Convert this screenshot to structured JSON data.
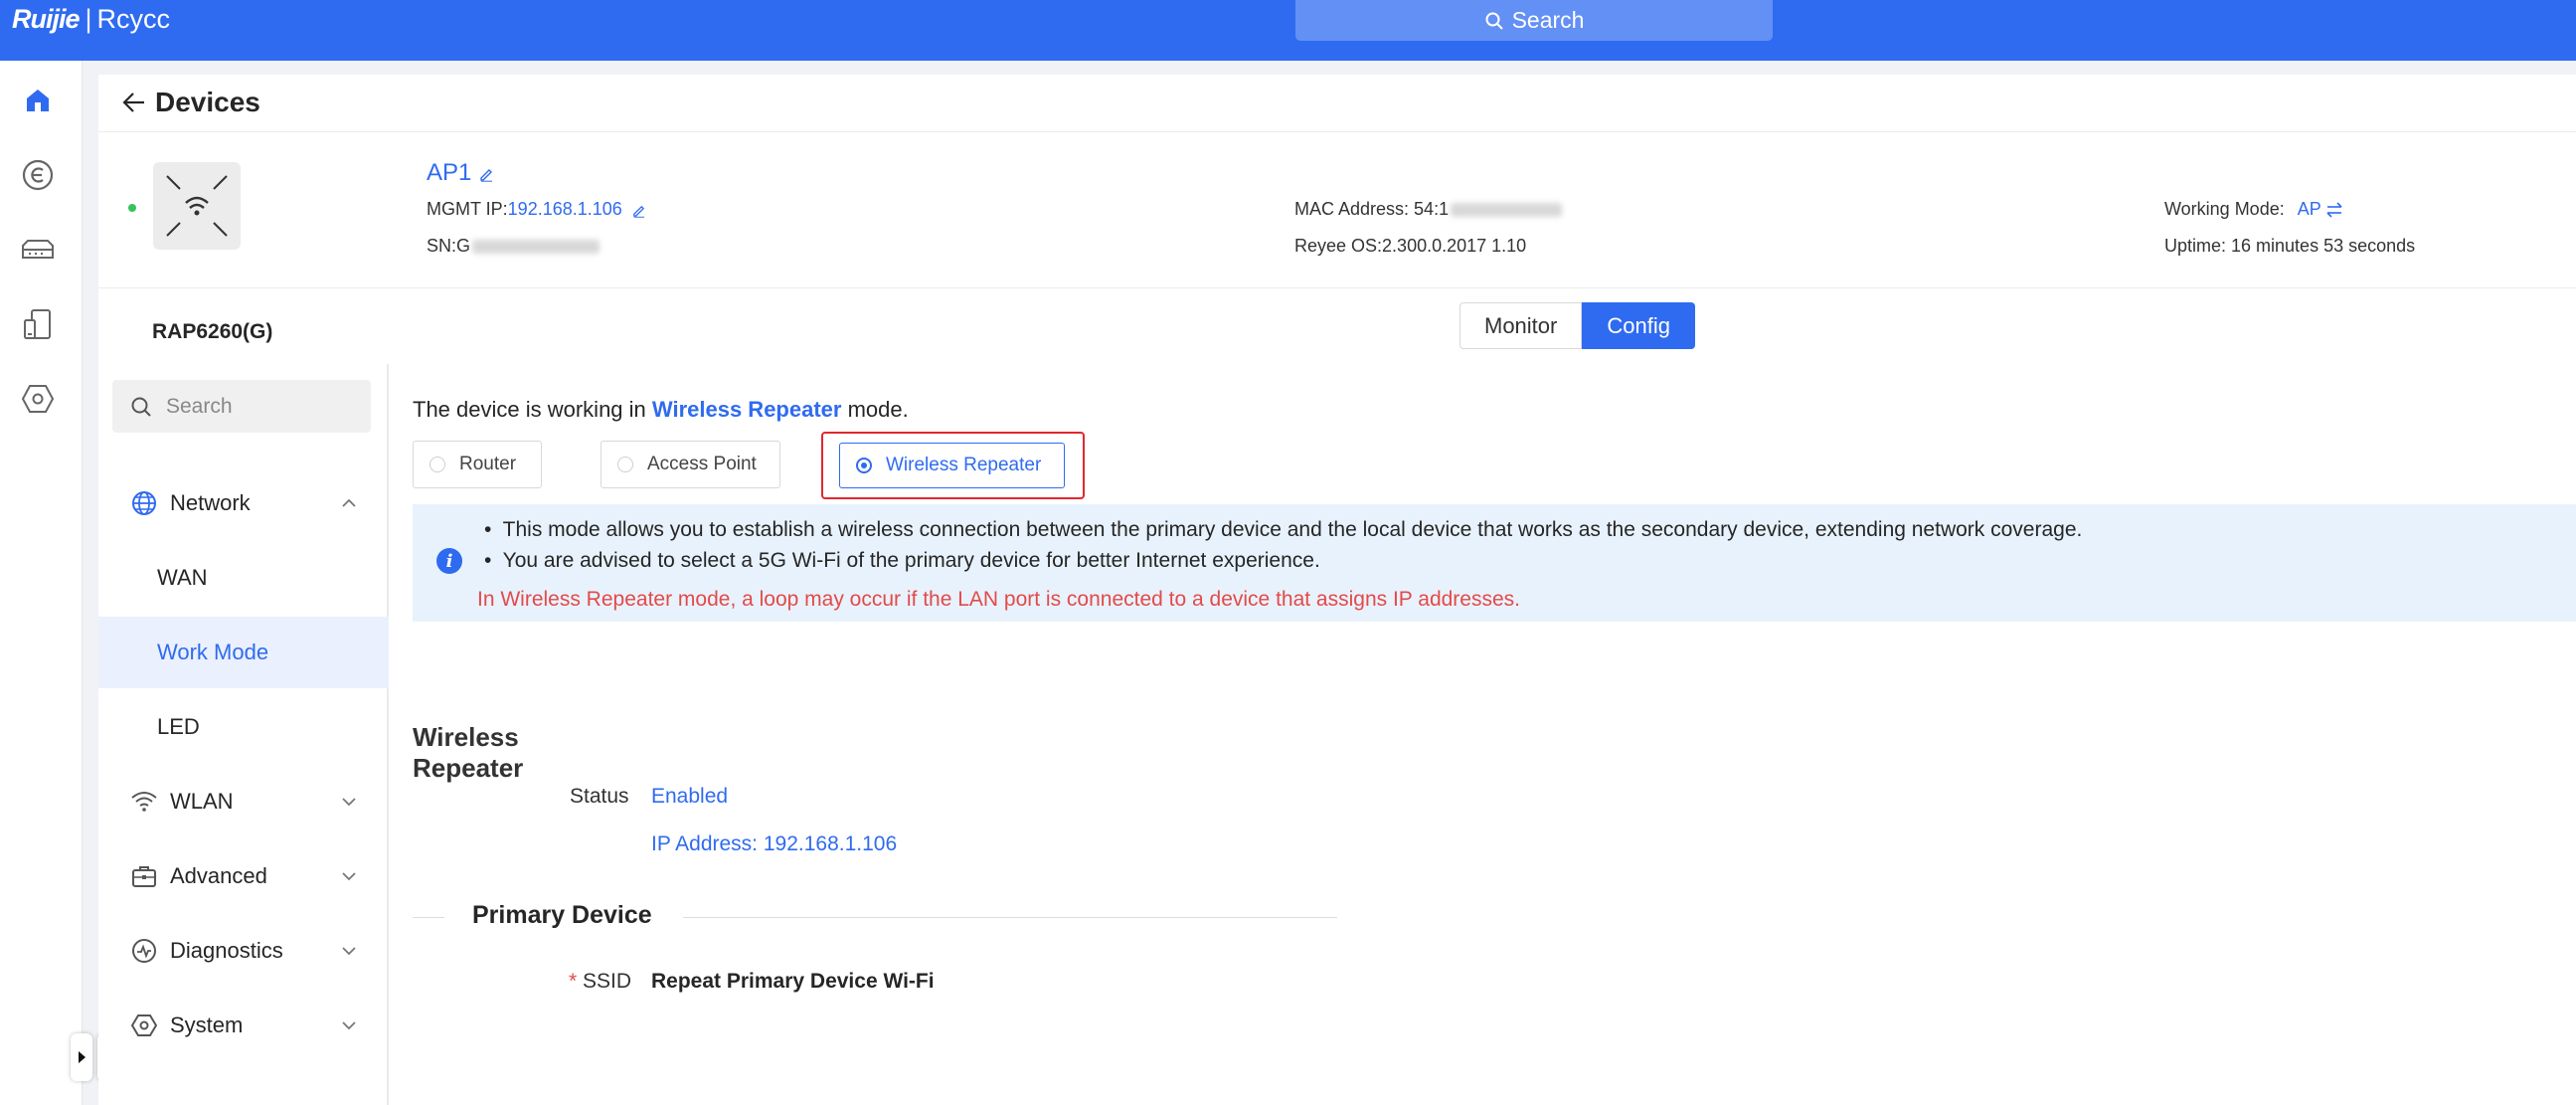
{
  "header": {
    "logo_primary": "Ruijie",
    "logo_secondary": "Rcycc",
    "search_label": "Search"
  },
  "rail": {
    "items": [
      "home-icon",
      "cloud-service-icon",
      "switch-device-icon",
      "client-device-icon",
      "settings-hex-icon"
    ]
  },
  "page": {
    "title": "Devices"
  },
  "device": {
    "model": "RAP6260(G)",
    "name": "AP1",
    "mgmt_ip_label": "MGMT IP:",
    "mgmt_ip": "192.168.1.106",
    "sn_label": "SN:",
    "sn_visible": "G",
    "mac_label": "MAC Address: ",
    "mac_visible": "54:1",
    "os_text": "Reyee OS:2.300.0.2017 1.10",
    "working_mode_label": "Working Mode:",
    "working_mode": "AP",
    "uptime_text": "Uptime: 16 minutes 53 seconds"
  },
  "tabs": {
    "monitor": "Monitor",
    "config": "Config",
    "active": "Config"
  },
  "menu": {
    "search_placeholder": "Search",
    "network": "Network",
    "wan": "WAN",
    "work_mode": "Work Mode",
    "led": "LED",
    "wlan": "WLAN",
    "advanced": "Advanced",
    "diagnostics": "Diagnostics",
    "system": "System",
    "active": "Work Mode"
  },
  "content": {
    "mode_prefix": "The device is working in ",
    "mode_name": "Wireless Repeater",
    "mode_suffix": " mode.",
    "modes": {
      "router": "Router",
      "access_point": "Access Point",
      "wireless_repeater": "Wireless Repeater",
      "selected": "Wireless Repeater"
    },
    "notice_1": "This mode allows you to establish a wireless connection between the primary device and the local device that works as the secondary device, extending network coverage.",
    "notice_2": "You are advised to select a 5G Wi-Fi of the primary device for better Internet experience.",
    "notice_warning": "In Wireless Repeater mode, a loop may occur if the LAN port is connected to a device that assigns IP addresses.",
    "section_title": "Wireless Repeater",
    "status_label": "Status",
    "status_value": "Enabled",
    "ip_text": "IP Address: 192.168.1.106",
    "primary_title": "Primary Device",
    "ssid_required": "*",
    "ssid_label": "SSID",
    "ssid_value": "Repeat Primary Device Wi-Fi"
  },
  "colors": {
    "brand": "#2f6bf0",
    "warning": "#e34a4a",
    "highlight": "#e0282e",
    "online": "#36c45a"
  }
}
